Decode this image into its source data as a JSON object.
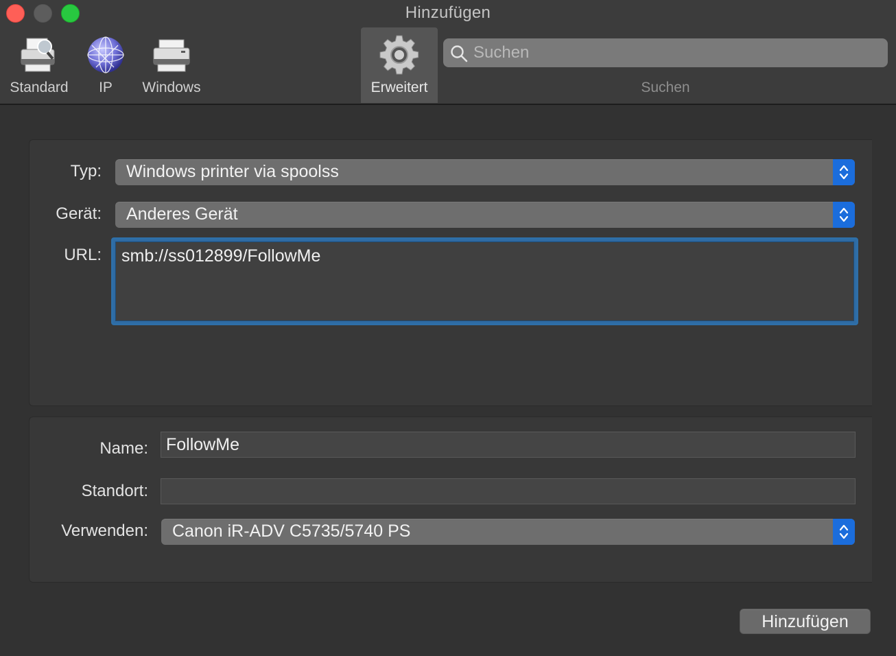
{
  "window": {
    "title": "Hinzufügen"
  },
  "toolbar": {
    "items": [
      {
        "label": "Standard",
        "icon": "default-printer-icon"
      },
      {
        "label": "IP",
        "icon": "network-globe-icon"
      },
      {
        "label": "Windows",
        "icon": "windows-printer-icon"
      },
      {
        "label": "Erweitert",
        "icon": "gear-icon",
        "active": true
      }
    ],
    "search": {
      "placeholder": "Suchen",
      "value": "",
      "label": "Suchen"
    }
  },
  "connection": {
    "type_label": "Typ:",
    "type_value": "Windows printer via spoolss",
    "device_label": "Gerät:",
    "device_value": "Anderes Gerät",
    "url_label": "URL:",
    "url_value": "smb://ss012899/FollowMe"
  },
  "details": {
    "name_label": "Name:",
    "name_value": "FollowMe",
    "location_label": "Standort:",
    "location_value": "",
    "use_label": "Verwenden:",
    "use_value": "Canon iR-ADV C5735/5740 PS"
  },
  "footer": {
    "add_label": "Hinzufügen"
  },
  "colors": {
    "accent": "#1b6ddc",
    "window_bg": "#323232",
    "close": "#fe5f57",
    "zoom": "#28c840"
  }
}
